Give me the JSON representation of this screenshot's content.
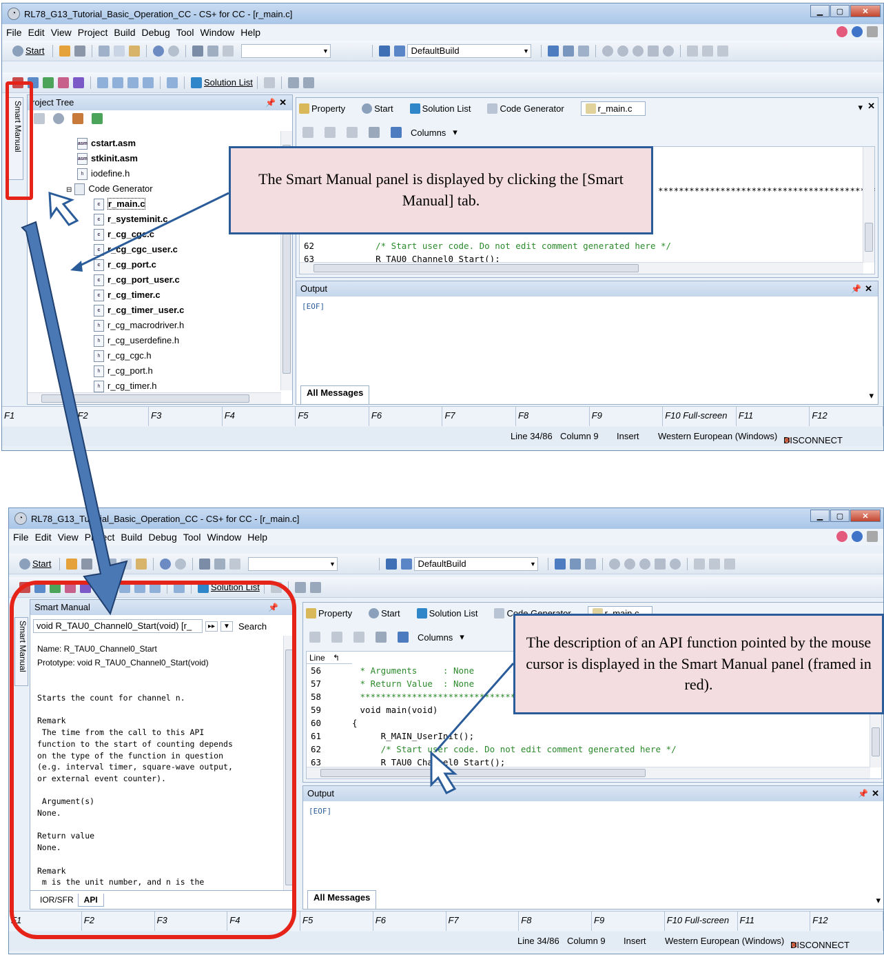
{
  "top": {
    "title": "RL78_G13_Tutorial_Basic_Operation_CC - CS+ for CC - [r_main.c]",
    "menu": [
      "File",
      "Edit",
      "View",
      "Project",
      "Build",
      "Debug",
      "Tool",
      "Window",
      "Help"
    ],
    "toolbar": {
      "start": "Start",
      "build_config": "DefaultBuild",
      "solution_list": "Solution List"
    },
    "project_tree": {
      "title": "roject Tree",
      "vtab": "Smart Manual",
      "items": [
        {
          "label": "cstart.asm",
          "bold": true,
          "icon": "asm"
        },
        {
          "label": "stkinit.asm",
          "bold": true,
          "icon": "asm"
        },
        {
          "label": "iodefine.h",
          "bold": false,
          "icon": "h"
        },
        {
          "label": "Code Generator",
          "bold": false,
          "icon": "folder"
        },
        {
          "label": "r_main.c",
          "bold": true,
          "icon": "c"
        },
        {
          "label": "r_systeminit.c",
          "bold": true,
          "icon": "c"
        },
        {
          "label": "r_cg_cgc.c",
          "bold": true,
          "icon": "c"
        },
        {
          "label": "r_cg_cgc_user.c",
          "bold": true,
          "icon": "c"
        },
        {
          "label": "r_cg_port.c",
          "bold": true,
          "icon": "c"
        },
        {
          "label": "r_cg_port_user.c",
          "bold": true,
          "icon": "c"
        },
        {
          "label": "r_cg_timer.c",
          "bold": true,
          "icon": "c"
        },
        {
          "label": "r_cg_timer_user.c",
          "bold": true,
          "icon": "c"
        },
        {
          "label": "r_cg_macrodriver.h",
          "bold": false,
          "icon": "h"
        },
        {
          "label": "r_cg_userdefine.h",
          "bold": false,
          "icon": "h"
        },
        {
          "label": "r_cg_cgc.h",
          "bold": false,
          "icon": "h"
        },
        {
          "label": "r_cg_port.h",
          "bold": false,
          "icon": "h"
        },
        {
          "label": "r_cg_timer.h",
          "bold": false,
          "icon": "h"
        }
      ]
    },
    "doc_tabs": [
      "Property",
      "Start",
      "Solution List",
      "Code Generator",
      "r_main.c"
    ],
    "editor": {
      "columns": "Columns",
      "stars": "******************************************",
      "lines": [
        {
          "no": "62",
          "code": "    /* Start user code. Do not edit comment generated here */"
        },
        {
          "no": "63",
          "code": "    R_TAU0_Channel0_Start();"
        }
      ]
    },
    "output": {
      "title": "Output",
      "content": "[EOF]",
      "tab": "All Messages"
    },
    "fkeys": [
      "F1",
      "F2",
      "F3",
      "F4",
      "F5",
      "F6",
      "F7",
      "F8",
      "F9",
      "F10 Full-screen",
      "F11",
      "F12"
    ],
    "status": {
      "line": "Line 34/86",
      "col": "Column 9",
      "mode": "Insert",
      "enc": "Western European (Windows)",
      "conn": "DISCONNECT"
    },
    "callout": "The Smart Manual panel is displayed by clicking the [Smart Manual] tab."
  },
  "bottom": {
    "title": "RL78_G13_Tutorial_Basic_Operation_CC - CS+ for CC - [r_main.c]",
    "menu": [
      "File",
      "Edit",
      "View",
      "Project",
      "Build",
      "Debug",
      "Tool",
      "Window",
      "Help"
    ],
    "toolbar": {
      "start": "Start",
      "build_config": "DefaultBuild",
      "solution_list": "Solution List"
    },
    "smart_manual": {
      "title": "Smart Manual",
      "vtab": "Smart Manual",
      "search_value": "void R_TAU0_Channel0_Start(void) [r_",
      "search_btn": "Search",
      "name": "Name: R_TAU0_Channel0_Start",
      "prototype": "Prototype: void R_TAU0_Channel0_Start(void)",
      "body": "Starts the count for channel n.\n\nRemark\n The time from the call to this API\nfunction to the start of counting depends\non the type of the function in question\n(e.g. interval timer, square-wave output,\nor external event counter).\n\n Argument(s)\nNone.\n\nReturn value\nNone.\n\nRemark\n m is the unit number, and n is the",
      "tabs": [
        "IOR/SFR",
        "API"
      ]
    },
    "doc_tabs": [
      "Property",
      "Start",
      "Solution List",
      "Code Generator",
      "r_main.c"
    ],
    "editor": {
      "columns": "Columns",
      "line_header": "Line",
      "lines": [
        {
          "no": "56",
          "code": " * Arguments     : None"
        },
        {
          "no": "57",
          "code": " * Return Value  : None"
        },
        {
          "no": "58",
          "code": " ******************************************"
        },
        {
          "no": "59",
          "code": " void main(void)"
        },
        {
          "no": "60",
          "code": "{"
        },
        {
          "no": "61",
          "code": "     R_MAIN_UserInit();"
        },
        {
          "no": "62",
          "code": "     /* Start user code. Do not edit comment generated here */"
        },
        {
          "no": "63",
          "code": "     R_TAU0_Channel0_Start();"
        }
      ]
    },
    "output": {
      "title": "Output",
      "content": "[EOF]",
      "tab": "All Messages"
    },
    "fkeys": [
      "F1",
      "F2",
      "F3",
      "F4",
      "F5",
      "F6",
      "F7",
      "F8",
      "F9",
      "F10 Full-screen",
      "F11",
      "F12"
    ],
    "status": {
      "line": "Line 34/86",
      "col": "Column 9",
      "mode": "Insert",
      "enc": "Western European (Windows)",
      "conn": "DISCONNECT"
    },
    "callout": "The description of an API function pointed by the mouse cursor is displayed in the Smart Manual panel (framed in red)."
  },
  "colors": {
    "callout_bg": "#f3dde0",
    "callout_border": "#2b5c9a",
    "highlight_red": "#e52318",
    "arrow_blue": "#4a78b5"
  }
}
